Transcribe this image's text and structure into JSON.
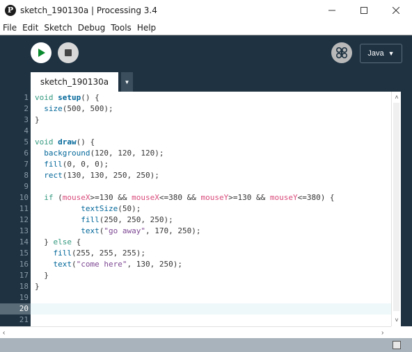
{
  "window": {
    "title": "sketch_190130a | Processing 3.4",
    "app_icon_glyph": "P"
  },
  "menu": [
    "File",
    "Edit",
    "Sketch",
    "Debug",
    "Tools",
    "Help"
  ],
  "toolbar": {
    "mode_label": "Java",
    "mode_arrow": "▼"
  },
  "tabs": {
    "active_label": "sketch_190130a",
    "menu_arrow": "▼"
  },
  "editor": {
    "current_line": 20,
    "lines": [
      {
        "n": "1",
        "html": "<span class=\"kw\">void</span> <span class=\"fn\">setup</span>() {"
      },
      {
        "n": "2",
        "html": "  <span class=\"api\">size</span>(500, 500);"
      },
      {
        "n": "3",
        "html": "}"
      },
      {
        "n": "4",
        "html": ""
      },
      {
        "n": "5",
        "html": "<span class=\"kw\">void</span> <span class=\"fn\">draw</span>() {"
      },
      {
        "n": "6",
        "html": "  <span class=\"api\">background</span>(120, 120, 120);"
      },
      {
        "n": "7",
        "html": "  <span class=\"api\">fill</span>(0, 0, 0);"
      },
      {
        "n": "8",
        "html": "  <span class=\"api\">rect</span>(130, 130, 250, 250);"
      },
      {
        "n": "9",
        "html": ""
      },
      {
        "n": "10",
        "html": "  <span class=\"kw\">if</span> (<span class=\"var\">mouseX</span>>=130 && <span class=\"var\">mouseX</span><=380 && <span class=\"var\">mouseY</span>>=130 && <span class=\"var\">mouseY</span><=380) {"
      },
      {
        "n": "11",
        "html": "          <span class=\"api\">textSize</span>(50);"
      },
      {
        "n": "12",
        "html": "          <span class=\"api\">fill</span>(250, 250, 250);"
      },
      {
        "n": "13",
        "html": "          <span class=\"api\">text</span>(<span class=\"str\">\"go away\"</span>, 170, 250);"
      },
      {
        "n": "14",
        "html": "  } <span class=\"kw\">else</span> {"
      },
      {
        "n": "15",
        "html": "    <span class=\"api\">fill</span>(255, 255, 255);"
      },
      {
        "n": "16",
        "html": "    <span class=\"api\">text</span>(<span class=\"str\">\"come here\"</span>, 130, 250);"
      },
      {
        "n": "17",
        "html": "  }"
      },
      {
        "n": "18",
        "html": "}"
      },
      {
        "n": "19",
        "html": ""
      },
      {
        "n": "20",
        "html": ""
      },
      {
        "n": "21",
        "html": ""
      }
    ]
  },
  "colors": {
    "toolbar_bg": "#1e3242",
    "keyword": "#33997e",
    "function": "#006699",
    "variable": "#d94a7a",
    "string": "#7d4793"
  }
}
